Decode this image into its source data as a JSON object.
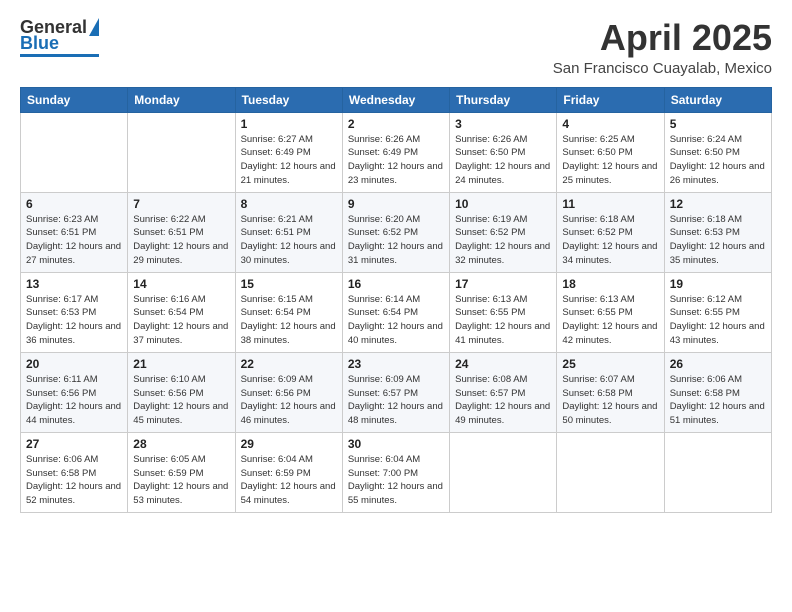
{
  "logo": {
    "general": "General",
    "blue": "Blue"
  },
  "title": {
    "month": "April 2025",
    "location": "San Francisco Cuayalab, Mexico"
  },
  "weekdays": [
    "Sunday",
    "Monday",
    "Tuesday",
    "Wednesday",
    "Thursday",
    "Friday",
    "Saturday"
  ],
  "weeks": [
    [
      {
        "day": "",
        "sunrise": "",
        "sunset": "",
        "daylight": ""
      },
      {
        "day": "",
        "sunrise": "",
        "sunset": "",
        "daylight": ""
      },
      {
        "day": "1",
        "sunrise": "Sunrise: 6:27 AM",
        "sunset": "Sunset: 6:49 PM",
        "daylight": "Daylight: 12 hours and 21 minutes."
      },
      {
        "day": "2",
        "sunrise": "Sunrise: 6:26 AM",
        "sunset": "Sunset: 6:49 PM",
        "daylight": "Daylight: 12 hours and 23 minutes."
      },
      {
        "day": "3",
        "sunrise": "Sunrise: 6:26 AM",
        "sunset": "Sunset: 6:50 PM",
        "daylight": "Daylight: 12 hours and 24 minutes."
      },
      {
        "day": "4",
        "sunrise": "Sunrise: 6:25 AM",
        "sunset": "Sunset: 6:50 PM",
        "daylight": "Daylight: 12 hours and 25 minutes."
      },
      {
        "day": "5",
        "sunrise": "Sunrise: 6:24 AM",
        "sunset": "Sunset: 6:50 PM",
        "daylight": "Daylight: 12 hours and 26 minutes."
      }
    ],
    [
      {
        "day": "6",
        "sunrise": "Sunrise: 6:23 AM",
        "sunset": "Sunset: 6:51 PM",
        "daylight": "Daylight: 12 hours and 27 minutes."
      },
      {
        "day": "7",
        "sunrise": "Sunrise: 6:22 AM",
        "sunset": "Sunset: 6:51 PM",
        "daylight": "Daylight: 12 hours and 29 minutes."
      },
      {
        "day": "8",
        "sunrise": "Sunrise: 6:21 AM",
        "sunset": "Sunset: 6:51 PM",
        "daylight": "Daylight: 12 hours and 30 minutes."
      },
      {
        "day": "9",
        "sunrise": "Sunrise: 6:20 AM",
        "sunset": "Sunset: 6:52 PM",
        "daylight": "Daylight: 12 hours and 31 minutes."
      },
      {
        "day": "10",
        "sunrise": "Sunrise: 6:19 AM",
        "sunset": "Sunset: 6:52 PM",
        "daylight": "Daylight: 12 hours and 32 minutes."
      },
      {
        "day": "11",
        "sunrise": "Sunrise: 6:18 AM",
        "sunset": "Sunset: 6:52 PM",
        "daylight": "Daylight: 12 hours and 34 minutes."
      },
      {
        "day": "12",
        "sunrise": "Sunrise: 6:18 AM",
        "sunset": "Sunset: 6:53 PM",
        "daylight": "Daylight: 12 hours and 35 minutes."
      }
    ],
    [
      {
        "day": "13",
        "sunrise": "Sunrise: 6:17 AM",
        "sunset": "Sunset: 6:53 PM",
        "daylight": "Daylight: 12 hours and 36 minutes."
      },
      {
        "day": "14",
        "sunrise": "Sunrise: 6:16 AM",
        "sunset": "Sunset: 6:54 PM",
        "daylight": "Daylight: 12 hours and 37 minutes."
      },
      {
        "day": "15",
        "sunrise": "Sunrise: 6:15 AM",
        "sunset": "Sunset: 6:54 PM",
        "daylight": "Daylight: 12 hours and 38 minutes."
      },
      {
        "day": "16",
        "sunrise": "Sunrise: 6:14 AM",
        "sunset": "Sunset: 6:54 PM",
        "daylight": "Daylight: 12 hours and 40 minutes."
      },
      {
        "day": "17",
        "sunrise": "Sunrise: 6:13 AM",
        "sunset": "Sunset: 6:55 PM",
        "daylight": "Daylight: 12 hours and 41 minutes."
      },
      {
        "day": "18",
        "sunrise": "Sunrise: 6:13 AM",
        "sunset": "Sunset: 6:55 PM",
        "daylight": "Daylight: 12 hours and 42 minutes."
      },
      {
        "day": "19",
        "sunrise": "Sunrise: 6:12 AM",
        "sunset": "Sunset: 6:55 PM",
        "daylight": "Daylight: 12 hours and 43 minutes."
      }
    ],
    [
      {
        "day": "20",
        "sunrise": "Sunrise: 6:11 AM",
        "sunset": "Sunset: 6:56 PM",
        "daylight": "Daylight: 12 hours and 44 minutes."
      },
      {
        "day": "21",
        "sunrise": "Sunrise: 6:10 AM",
        "sunset": "Sunset: 6:56 PM",
        "daylight": "Daylight: 12 hours and 45 minutes."
      },
      {
        "day": "22",
        "sunrise": "Sunrise: 6:09 AM",
        "sunset": "Sunset: 6:56 PM",
        "daylight": "Daylight: 12 hours and 46 minutes."
      },
      {
        "day": "23",
        "sunrise": "Sunrise: 6:09 AM",
        "sunset": "Sunset: 6:57 PM",
        "daylight": "Daylight: 12 hours and 48 minutes."
      },
      {
        "day": "24",
        "sunrise": "Sunrise: 6:08 AM",
        "sunset": "Sunset: 6:57 PM",
        "daylight": "Daylight: 12 hours and 49 minutes."
      },
      {
        "day": "25",
        "sunrise": "Sunrise: 6:07 AM",
        "sunset": "Sunset: 6:58 PM",
        "daylight": "Daylight: 12 hours and 50 minutes."
      },
      {
        "day": "26",
        "sunrise": "Sunrise: 6:06 AM",
        "sunset": "Sunset: 6:58 PM",
        "daylight": "Daylight: 12 hours and 51 minutes."
      }
    ],
    [
      {
        "day": "27",
        "sunrise": "Sunrise: 6:06 AM",
        "sunset": "Sunset: 6:58 PM",
        "daylight": "Daylight: 12 hours and 52 minutes."
      },
      {
        "day": "28",
        "sunrise": "Sunrise: 6:05 AM",
        "sunset": "Sunset: 6:59 PM",
        "daylight": "Daylight: 12 hours and 53 minutes."
      },
      {
        "day": "29",
        "sunrise": "Sunrise: 6:04 AM",
        "sunset": "Sunset: 6:59 PM",
        "daylight": "Daylight: 12 hours and 54 minutes."
      },
      {
        "day": "30",
        "sunrise": "Sunrise: 6:04 AM",
        "sunset": "Sunset: 7:00 PM",
        "daylight": "Daylight: 12 hours and 55 minutes."
      },
      {
        "day": "",
        "sunrise": "",
        "sunset": "",
        "daylight": ""
      },
      {
        "day": "",
        "sunrise": "",
        "sunset": "",
        "daylight": ""
      },
      {
        "day": "",
        "sunrise": "",
        "sunset": "",
        "daylight": ""
      }
    ]
  ]
}
